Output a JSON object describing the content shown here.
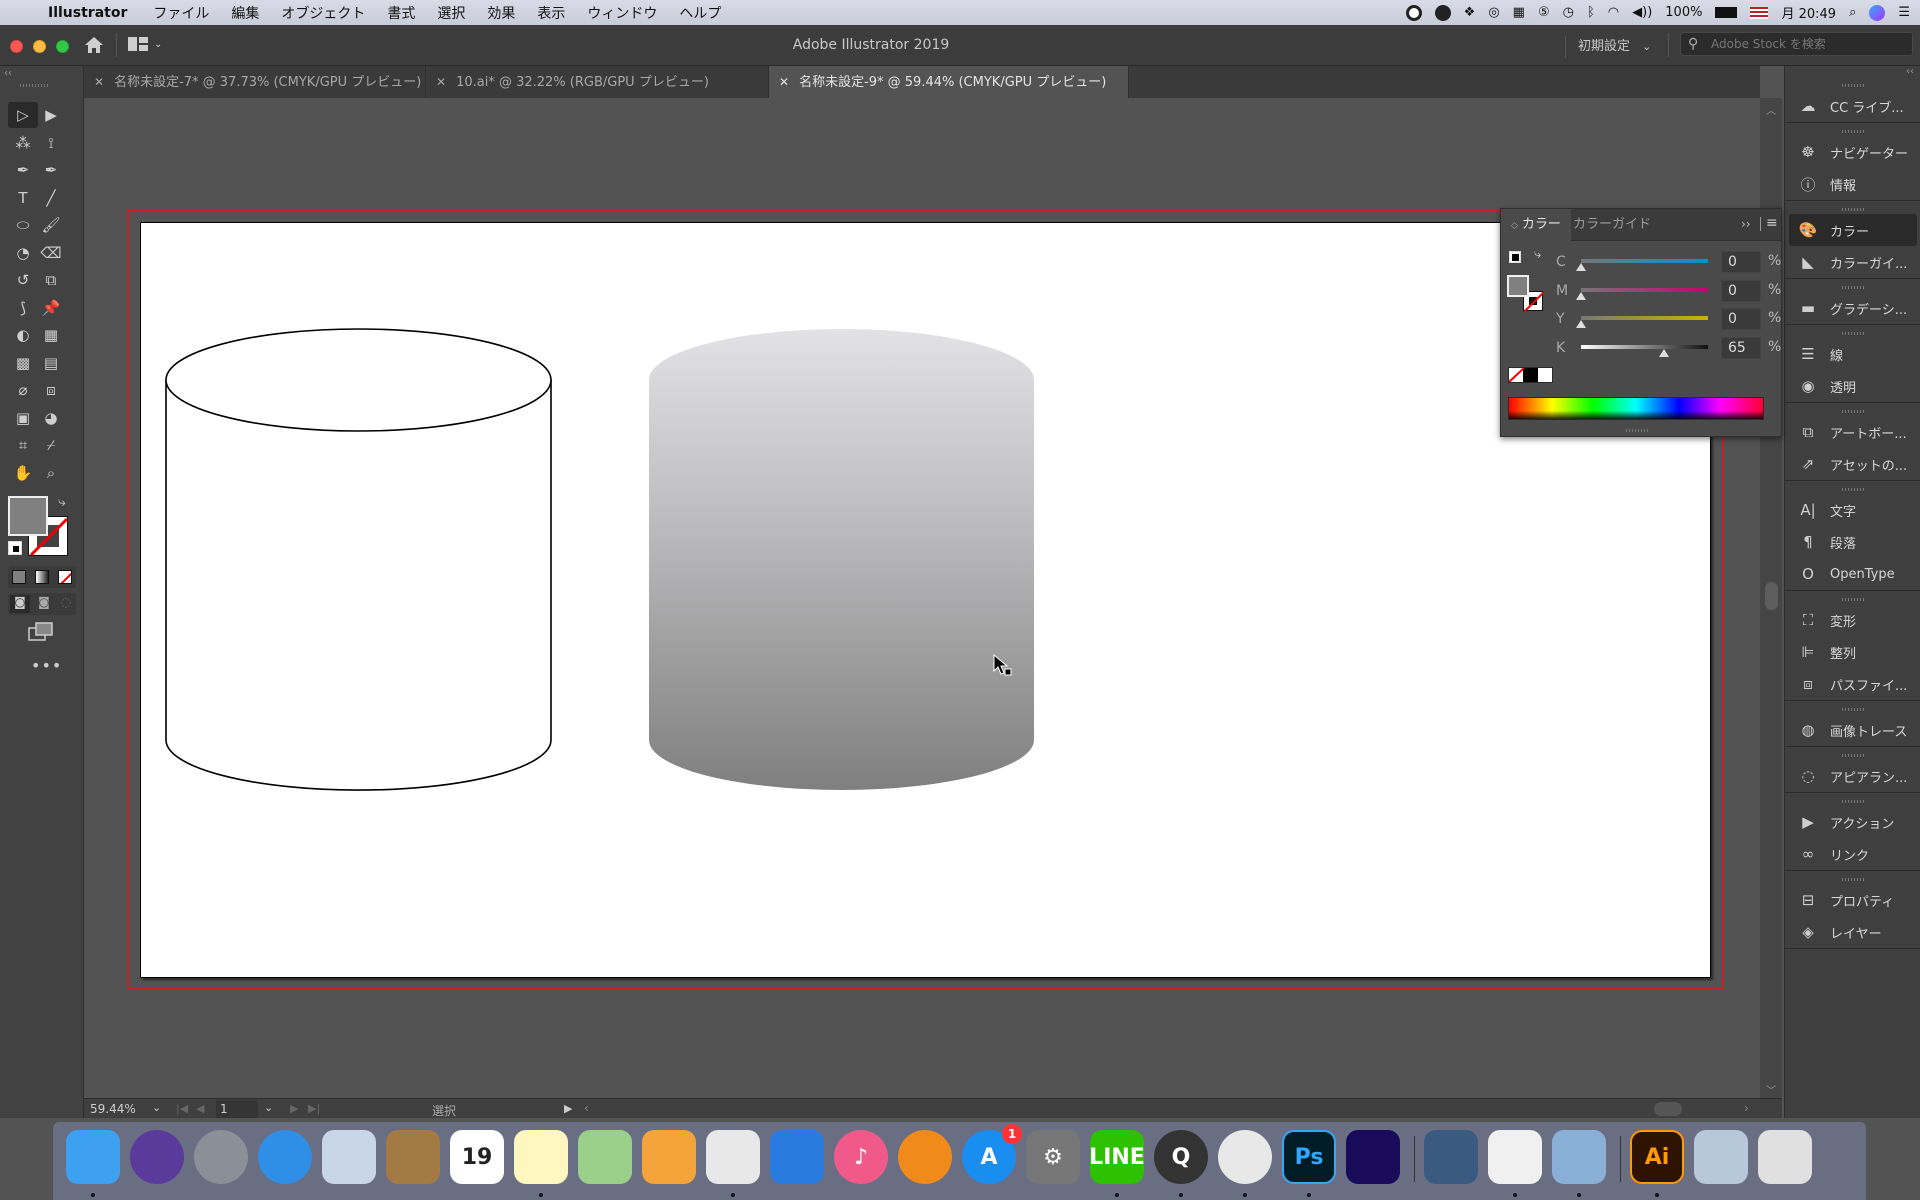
{
  "menubar": {
    "app_name": "Illustrator",
    "items": [
      "ファイル",
      "編集",
      "オブジェクト",
      "書式",
      "選択",
      "効果",
      "表示",
      "ウィンドウ",
      "ヘルプ"
    ],
    "battery": "100%",
    "clock": "月 20:49"
  },
  "titlebar": {
    "title": "Adobe Illustrator 2019",
    "workspace": "初期設定",
    "stock_search_placeholder": "Adobe Stock を検索"
  },
  "tabs": [
    {
      "label": "名称未設定-7* @ 37.73% (CMYK/GPU プレビュー)",
      "active": false
    },
    {
      "label": "10.ai* @ 32.22% (RGB/GPU プレビュー)",
      "active": false
    },
    {
      "label": "名称未設定-9* @ 59.44% (CMYK/GPU プレビュー)",
      "active": true
    }
  ],
  "tools": [
    "selection-tool",
    "direct-selection-tool",
    "magic-wand-tool",
    "lasso-tool",
    "pen-tool",
    "curvature-tool",
    "type-tool",
    "line-segment-tool",
    "ellipse-tool",
    "paintbrush-tool",
    "shaper-tool",
    "eraser-tool",
    "rotate-tool",
    "scale-tool",
    "puppet-warp-tool",
    "pin-tool",
    "shape-builder-tool",
    "perspective-grid-tool",
    "mesh-tool",
    "gradient-tool",
    "eyedropper-tool",
    "blend-tool",
    "symbol-sprayer-tool",
    "graph-tool",
    "artboard-tool",
    "slice-tool",
    "hand-tool",
    "zoom-tool"
  ],
  "fill_color": "#808080",
  "color_panel": {
    "tabs": [
      "カラー",
      "カラーガイド"
    ],
    "sliders": [
      {
        "label": "C",
        "value": "0",
        "percent": 0,
        "color": "#0094c8"
      },
      {
        "label": "M",
        "value": "0",
        "percent": 0,
        "color": "#c8006e"
      },
      {
        "label": "Y",
        "value": "0",
        "percent": 0,
        "color": "#c8b400"
      },
      {
        "label": "K",
        "value": "65",
        "percent": 65,
        "color": "#000000"
      }
    ],
    "unit": "%"
  },
  "right_panels": [
    {
      "group": [
        {
          "label": "CC ライブ...",
          "icon": "cc-libraries-icon"
        }
      ]
    },
    {
      "group": [
        {
          "label": "ナビゲーター",
          "icon": "navigator-icon"
        },
        {
          "label": "情報",
          "icon": "info-icon"
        }
      ]
    },
    {
      "group": [
        {
          "label": "カラー",
          "icon": "color-palette-icon",
          "active": true
        },
        {
          "label": "カラーガイ...",
          "icon": "color-guide-icon"
        }
      ]
    },
    {
      "group": [
        {
          "label": "グラデーシ...",
          "icon": "gradient-icon"
        }
      ]
    },
    {
      "group": [
        {
          "label": "線",
          "icon": "stroke-icon"
        },
        {
          "label": "透明",
          "icon": "transparency-icon"
        }
      ]
    },
    {
      "group": [
        {
          "label": "アートボー...",
          "icon": "artboards-icon"
        },
        {
          "label": "アセットの...",
          "icon": "asset-export-icon"
        }
      ]
    },
    {
      "group": [
        {
          "label": "文字",
          "icon": "character-icon"
        },
        {
          "label": "段落",
          "icon": "paragraph-icon"
        },
        {
          "label": "OpenType",
          "icon": "opentype-icon"
        }
      ]
    },
    {
      "group": [
        {
          "label": "変形",
          "icon": "transform-icon"
        },
        {
          "label": "整列",
          "icon": "align-icon"
        },
        {
          "label": "パスファイ...",
          "icon": "pathfinder-icon"
        }
      ]
    },
    {
      "group": [
        {
          "label": "画像トレース",
          "icon": "image-trace-icon"
        }
      ]
    },
    {
      "group": [
        {
          "label": "アピアラン...",
          "icon": "appearance-icon"
        }
      ]
    },
    {
      "group": [
        {
          "label": "アクション",
          "icon": "actions-icon"
        },
        {
          "label": "リンク",
          "icon": "links-icon"
        }
      ]
    },
    {
      "group": [
        {
          "label": "プロパティ",
          "icon": "properties-icon"
        },
        {
          "label": "レイヤー",
          "icon": "layers-icon"
        }
      ]
    }
  ],
  "statusbar": {
    "zoom": "59.44%",
    "artboard_number": "1",
    "tool_status": "選択"
  },
  "artwork": {
    "outline_cylinder": {
      "stroke": "#000000",
      "fill": "#ffffff"
    },
    "gradient_cylinder": {
      "gradient_top": "#e2e2e4",
      "gradient_bottom": "#7f7f7f"
    }
  },
  "dock": [
    {
      "name": "finder",
      "label": "",
      "color": "#3ea0f0",
      "running": true
    },
    {
      "name": "siri",
      "label": "",
      "color": "#5a3a9a",
      "running": false
    },
    {
      "name": "launchpad",
      "label": "",
      "color": "#8a8f98",
      "running": false
    },
    {
      "name": "safari",
      "label": "",
      "color": "#2f8fe6",
      "running": false
    },
    {
      "name": "mail",
      "label": "",
      "color": "#c8d6e8",
      "running": false
    },
    {
      "name": "contacts",
      "label": "",
      "color": "#a47a44",
      "running": false
    },
    {
      "name": "calendar",
      "label": "19",
      "color": "#ffffff",
      "running": false
    },
    {
      "name": "notes",
      "label": "",
      "color": "#fff6c0",
      "running": true
    },
    {
      "name": "maps",
      "label": "",
      "color": "#9bd08a",
      "running": false
    },
    {
      "name": "pages",
      "label": "",
      "color": "#f3a43a",
      "running": false
    },
    {
      "name": "numbers",
      "label": "",
      "color": "#e8e8e8",
      "running": true
    },
    {
      "name": "keynote",
      "label": "",
      "color": "#2a7be0",
      "running": false
    },
    {
      "name": "itunes",
      "label": "♪",
      "color": "#f05a8a",
      "running": false
    },
    {
      "name": "ibooks",
      "label": "",
      "color": "#f08a1a",
      "running": false
    },
    {
      "name": "app-store",
      "label": "A",
      "color": "#1a8ef0",
      "running": false,
      "badge": "1"
    },
    {
      "name": "system-preferences",
      "label": "⚙",
      "color": "#777",
      "running": false
    },
    {
      "name": "line",
      "label": "LINE",
      "color": "#2dc100",
      "running": true
    },
    {
      "name": "quicktime",
      "label": "Q",
      "color": "#333",
      "running": true
    },
    {
      "name": "chrome",
      "label": "",
      "color": "#e8e8e8",
      "running": true
    },
    {
      "name": "photoshop",
      "label": "Ps",
      "color": "#001d26",
      "running": true
    },
    {
      "name": "media-encoder",
      "label": "",
      "color": "#1a0a5a",
      "running": false
    },
    {
      "name": "app-bull",
      "label": "",
      "color": "#3a5a80",
      "running": false
    },
    {
      "name": "textedit",
      "label": "",
      "color": "#f0f0f0",
      "running": true
    },
    {
      "name": "preview",
      "label": "",
      "color": "#8ab0d8",
      "running": true
    },
    {
      "name": "illustrator",
      "label": "Ai",
      "color": "#2d1300",
      "running": true
    },
    {
      "name": "photos-stack",
      "label": "",
      "color": "#b8c8d8",
      "running": false
    },
    {
      "name": "trash",
      "label": "",
      "color": "#e0e0e0",
      "running": false
    }
  ]
}
